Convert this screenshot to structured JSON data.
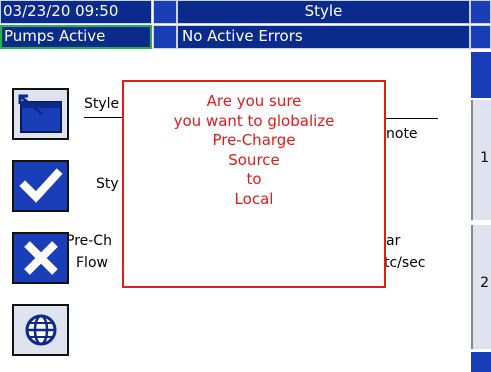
{
  "header": {
    "datetime": "03/23/20 09:50",
    "title": "Style",
    "status": "Pumps Active",
    "errors": "No Active Errors"
  },
  "sidebar": {
    "buttons": [
      {
        "name": "style-button",
        "icon": "style-edit-icon"
      },
      {
        "name": "accept-button",
        "icon": "checkmark-icon"
      },
      {
        "name": "cancel-button",
        "icon": "x-icon"
      },
      {
        "name": "globalize-button",
        "icon": "globe-icon"
      }
    ]
  },
  "background_fields": {
    "style_label": "Style",
    "style_label_2": "Sty",
    "pre_charge_label": "Pre-Ch",
    "flow_label": "Flow",
    "note_label": "note",
    "r_label": "ar",
    "units_label": "tc/sec"
  },
  "right_panel": {
    "tab1": "1",
    "tab2": "2"
  },
  "dialog": {
    "lines": [
      "Are you sure",
      "you want to globalize",
      "Pre-Charge",
      "Source",
      "to",
      "Local"
    ]
  },
  "colors": {
    "bar_background": "#0a2a8c",
    "accent_blue": "#1a3db8",
    "status_border": "#22b14c",
    "dialog_red": "#e21a1a"
  }
}
